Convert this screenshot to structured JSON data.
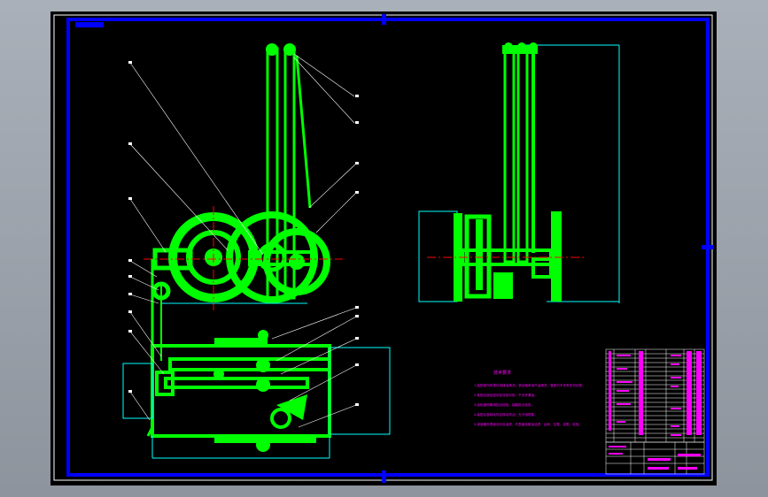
{
  "drawing": {
    "notes_title": "技术要求",
    "notes": [
      "1.装配前所有零件用煤油清洗，滚动轴承用汽油清洗，箱体内不许有任何杂物。",
      "2.各配合面及密封处涂密封胶，不允许漏油。",
      "3.齿轮副侧隙用铅丝检验，接触斑点检查。",
      "4.装配后各转动件应转动灵活，无卡阻现象。",
      "5.减速器外表面涂灰色油漆，内表面涂耐油油漆，运转，空载，加载，检验。"
    ],
    "colors": {
      "border": "#0000ff",
      "part": "#00ff00",
      "dim": "#00ffff",
      "leader": "#ffffff",
      "text": "#ff00ff",
      "center": "#ff0000"
    }
  }
}
